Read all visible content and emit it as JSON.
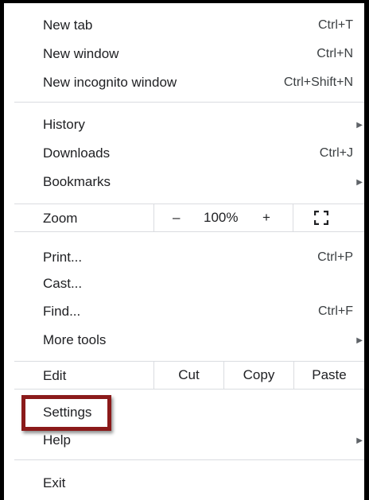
{
  "menu": {
    "new_tab": {
      "label": "New tab",
      "shortcut": "Ctrl+T"
    },
    "new_window": {
      "label": "New window",
      "shortcut": "Ctrl+N"
    },
    "new_incognito": {
      "label": "New incognito window",
      "shortcut": "Ctrl+Shift+N"
    },
    "history": {
      "label": "History"
    },
    "downloads": {
      "label": "Downloads",
      "shortcut": "Ctrl+J"
    },
    "bookmarks": {
      "label": "Bookmarks"
    },
    "zoom": {
      "label": "Zoom",
      "minus": "–",
      "level": "100%",
      "plus": "+"
    },
    "print": {
      "label": "Print...",
      "shortcut": "Ctrl+P"
    },
    "cast": {
      "label": "Cast..."
    },
    "find": {
      "label": "Find...",
      "shortcut": "Ctrl+F"
    },
    "more_tools": {
      "label": "More tools"
    },
    "edit": {
      "label": "Edit",
      "cut": "Cut",
      "copy": "Copy",
      "paste": "Paste"
    },
    "settings": {
      "label": "Settings"
    },
    "help": {
      "label": "Help"
    },
    "exit": {
      "label": "Exit"
    }
  },
  "submenu_arrow": "▶",
  "icons": {
    "submenu": "submenu-arrow-icon",
    "fullscreen": "fullscreen-icon"
  },
  "colors": {
    "highlight_border": "#8b1a1a",
    "separator": "#dadce0",
    "text": "#202124"
  }
}
